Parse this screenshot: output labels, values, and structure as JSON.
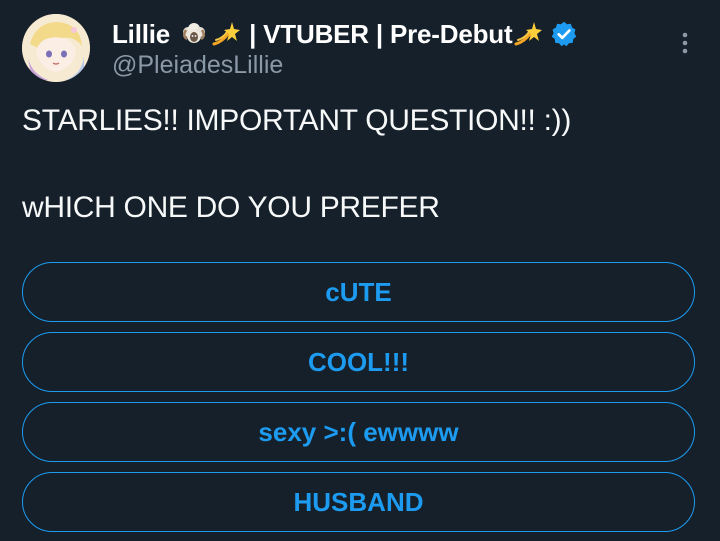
{
  "author": {
    "name": "Lillie",
    "name_suffix_emojis": [
      "ram-emoji-icon",
      "dizzy-emoji-icon"
    ],
    "name_tail": " | VTUBER | Pre-Debut",
    "tail_emoji": "dizzy-emoji-icon",
    "verified": true,
    "handle": "@PleiadesLillie"
  },
  "tweet": {
    "line1": "STARLIES!! IMPORTANT QUESTION!! :))",
    "line2": "wHICH ONE DO YOU PREFER"
  },
  "poll": {
    "options": [
      {
        "label": "cUTE"
      },
      {
        "label": "COOL!!!"
      },
      {
        "label": "sexy >:( ewwww"
      },
      {
        "label": "HUSBAND"
      }
    ]
  },
  "colors": {
    "background": "#15202b",
    "accent": "#1d9bf0",
    "text": "#f7f9f9",
    "muted": "#8b98a5"
  },
  "icons": {
    "more": "more-vertical-icon",
    "verified": "verified-badge-icon"
  }
}
